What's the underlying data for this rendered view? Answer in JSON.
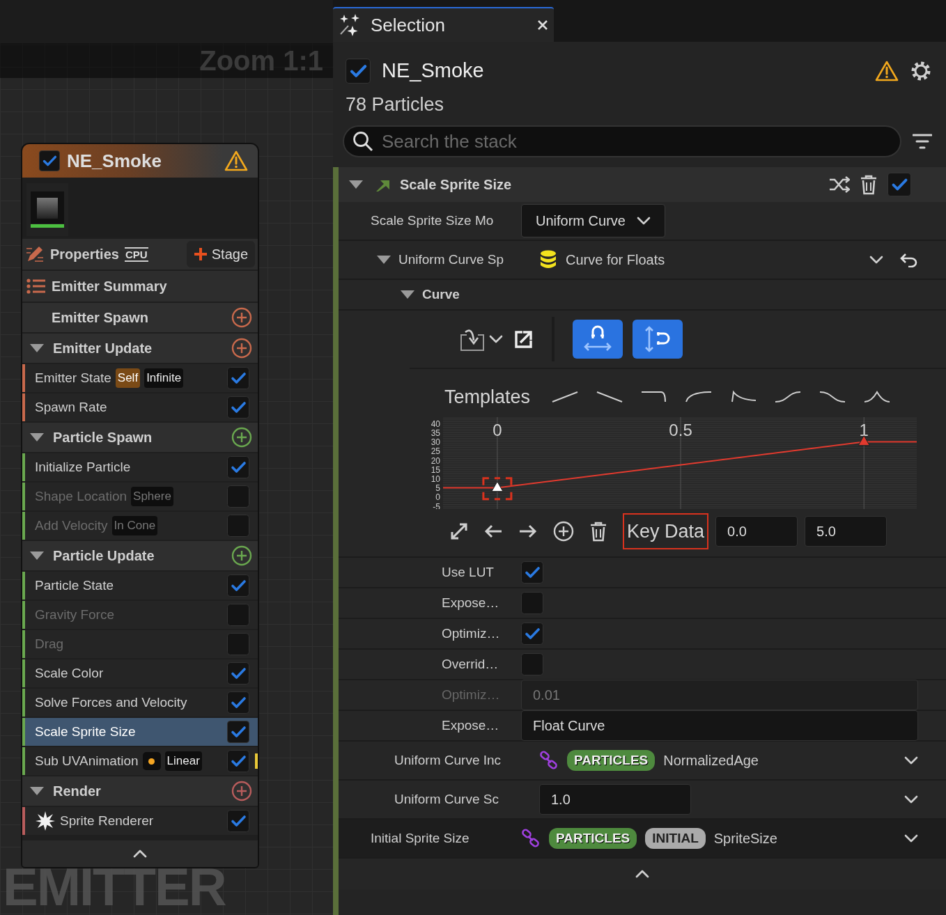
{
  "canvas": {
    "zoom_label": "Zoom 1:1",
    "watermark": "EMITTER"
  },
  "node": {
    "title": "NE_Smoke",
    "enabled": true,
    "warning": true,
    "toolbar": {
      "properties": "Properties",
      "cpu": "CPU",
      "stage": "Stage"
    },
    "summary": "Emitter Summary",
    "groups": [
      {
        "title": "Emitter Spawn",
        "collapsible": false,
        "color": "#c8694c"
      },
      {
        "title": "Emitter Update",
        "collapsible": true,
        "color": "#c8694c",
        "items": [
          {
            "kind": "module",
            "label": "Emitter State",
            "tags": [
              {
                "kind": "accent",
                "text": "Self"
              },
              {
                "kind": "plain",
                "text": "Infinite"
              }
            ],
            "checked": true,
            "selected": false,
            "flagged": false
          },
          {
            "kind": "module",
            "label": "Spawn Rate",
            "checked": true,
            "selected": false,
            "flagged": false
          }
        ]
      },
      {
        "title": "Particle Spawn",
        "collapsible": true,
        "color": "#6aa84f",
        "items": [
          {
            "kind": "module",
            "label": "Initialize Particle",
            "checked": true,
            "selected": false,
            "flagged": false
          },
          {
            "kind": "module",
            "label": "Shape Location",
            "tags": [
              {
                "kind": "plain",
                "text": "Sphere"
              }
            ],
            "checked": false,
            "selected": false,
            "flagged": false
          },
          {
            "kind": "module",
            "label": "Add Velocity",
            "tags": [
              {
                "kind": "plain",
                "text": "In Cone"
              }
            ],
            "checked": false,
            "selected": false,
            "flagged": false
          }
        ]
      },
      {
        "title": "Particle Update",
        "collapsible": true,
        "color": "#6aa84f",
        "items": [
          {
            "kind": "module",
            "label": "Particle State",
            "checked": true,
            "selected": false,
            "flagged": false
          },
          {
            "kind": "module",
            "label": "Gravity Force",
            "checked": false,
            "selected": false,
            "flagged": false
          },
          {
            "kind": "module",
            "label": "Drag",
            "checked": false,
            "selected": false,
            "flagged": false
          },
          {
            "kind": "module",
            "label": "Scale Color",
            "checked": true,
            "selected": false,
            "flagged": false
          },
          {
            "kind": "module",
            "label": "Solve Forces and Velocity",
            "checked": true,
            "selected": false,
            "flagged": false
          },
          {
            "kind": "module",
            "label": "Scale Sprite Size",
            "checked": true,
            "selected": true,
            "flagged": false
          },
          {
            "kind": "module",
            "label": "Sub UVAnimation",
            "tags": [
              {
                "kind": "dot"
              },
              {
                "kind": "plain",
                "text": "Linear"
              }
            ],
            "checked": true,
            "selected": false,
            "flagged": true
          }
        ]
      },
      {
        "title": "Render",
        "collapsible": true,
        "color": "#b85c5c",
        "items": [
          {
            "kind": "renderer",
            "label": "Sprite Renderer",
            "checked": true,
            "selected": false,
            "flagged": false
          }
        ]
      }
    ]
  },
  "panel": {
    "tab": {
      "label": "Selection"
    },
    "title": "NE_Smoke",
    "enabled": true,
    "warning": true,
    "subtitle": "78 Particles",
    "search": {
      "placeholder": "Search the stack"
    },
    "module": {
      "title": "Scale Sprite Size",
      "expanded": true,
      "enabled": true,
      "properties": [
        {
          "kind": "dropdown",
          "label": "Scale Sprite Size Mo",
          "value": "Uniform Curve",
          "children": [
            {
              "kind": "asset",
              "label": "Uniform Curve Sp",
              "value": "Curve for Floats",
              "expanded": true,
              "children": [
                {
                  "kind": "group",
                  "label": "Curve",
                  "expanded": true,
                  "children": [
                    {
                      "kind": "curve_editor",
                      "templates_label": "Templates",
                      "snap_time": true,
                      "snap_value": true,
                      "key_label": "Key Data",
                      "key_highlighted": true,
                      "key_time": "0.0",
                      "key_value": "5.0",
                      "keys": [
                        {
                          "selected": true
                        },
                        {
                          "selected": false
                        }
                      ],
                      "chart_data": {
                        "type": "line",
                        "x": [
                          -0.148,
                          0,
                          1,
                          1.144
                        ],
                        "grid": true,
                        "series": [
                          {
                            "color": "#e23a2e",
                            "marker": "triangle",
                            "values": [
                              5,
                              5,
                              30,
                              30
                            ]
                          }
                        ],
                        "xlim": [
                          -0.148,
                          1.144
                        ],
                        "ylim": [
                          -6.5,
                          43.5
                        ],
                        "xticks": [
                          0,
                          0.5,
                          1
                        ],
                        "yticks": [
                          -5,
                          0,
                          5,
                          10,
                          15,
                          20,
                          25,
                          30,
                          35,
                          40
                        ]
                      }
                    },
                    {
                      "kind": "checkbox",
                      "label": "Use LUT",
                      "checked": true
                    },
                    {
                      "kind": "checkbox",
                      "label": "Expose…",
                      "checked": false
                    },
                    {
                      "kind": "checkbox",
                      "label": "Optimiz…",
                      "checked": true
                    },
                    {
                      "kind": "checkbox",
                      "label": "Overrid…",
                      "checked": false
                    },
                    {
                      "kind": "text",
                      "label": "Optimiz…",
                      "value": "0.01",
                      "disabled": true
                    },
                    {
                      "kind": "text",
                      "label": "Expose…",
                      "value": "Float Curve",
                      "disabled": false
                    }
                  ]
                }
              ]
            },
            {
              "kind": "link",
              "label": "Uniform Curve Inc",
              "tags": [
                {
                  "kind": "namespace",
                  "text": "PARTICLES"
                }
              ],
              "value": "NormalizedAge"
            },
            {
              "kind": "number",
              "label": "Uniform Curve Sc",
              "value": "1.0"
            }
          ]
        },
        {
          "kind": "link",
          "label": "Initial Sprite Size",
          "tags": [
            {
              "kind": "namespace",
              "text": "PARTICLES"
            },
            {
              "kind": "modifier",
              "text": "INITIAL"
            }
          ],
          "value": "SpriteSize"
        }
      ]
    }
  }
}
